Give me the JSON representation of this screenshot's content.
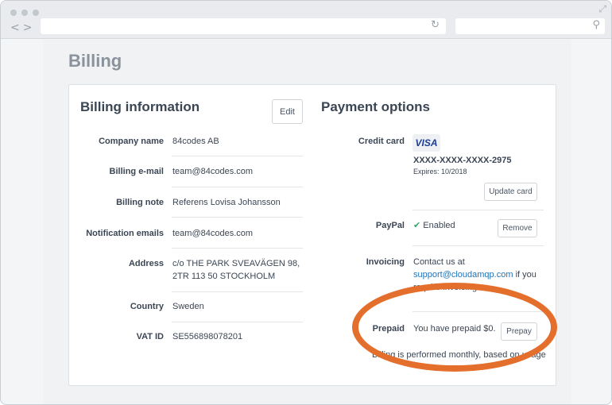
{
  "browser": {
    "icons": {
      "back_forward": "back-forward-arrows-icon",
      "reload": "reload-icon",
      "search": "search-icon",
      "expand": "expand-icon"
    }
  },
  "page": {
    "title": "Billing"
  },
  "billing_info": {
    "heading": "Billing information",
    "edit_label": "Edit",
    "rows": [
      {
        "label": "Company name",
        "value": "84codes AB"
      },
      {
        "label": "Billing e-mail",
        "value": "team@84codes.com"
      },
      {
        "label": "Billing note",
        "value": "Referens Lovisa Johansson"
      },
      {
        "label": "Notification emails",
        "value": "team@84codes.com"
      },
      {
        "label": "Address",
        "value_line1": "c/o THE PARK SVEAVÄGEN 98,",
        "value_line2": "2TR 113 50 STOCKHOLM"
      },
      {
        "label": "Country",
        "value": "Sweden"
      },
      {
        "label": "VAT ID",
        "value": "SE556898078201"
      }
    ]
  },
  "payment": {
    "heading": "Payment options",
    "credit_card": {
      "label": "Credit card",
      "brand": "VISA",
      "number": "XXXX-XXXX-XXXX-2975",
      "expires": "Expires: 10/2018",
      "update_label": "Update card"
    },
    "paypal": {
      "label": "PayPal",
      "check": "✔",
      "status": "Enabled",
      "remove_label": "Remove"
    },
    "invoicing": {
      "label": "Invoicing",
      "text_before": "Contact us at",
      "email": "support@cloudamqp.com",
      "text_after": " if you",
      "text_line3": "require invoicing."
    },
    "prepaid": {
      "label": "Prepaid",
      "text": "You have prepaid $0.",
      "button_label": "Prepay"
    },
    "footnote": "Billing is performed monthly, based on usage"
  },
  "colors": {
    "accent_link": "#1f73b7",
    "annotation": "#e46f2c",
    "check": "#3aa36b"
  }
}
